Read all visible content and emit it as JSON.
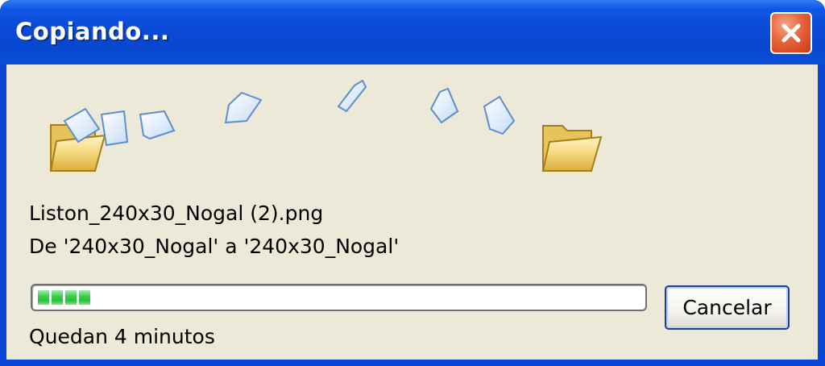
{
  "window": {
    "title": "Copiando...",
    "close_icon": "close-x-icon"
  },
  "animation": {
    "source_icon": "folder-open-icon",
    "destination_icon": "folder-icon",
    "flying_icon": "document-icon"
  },
  "file": {
    "name": "Liston_240x30_Nogal (2).png",
    "from_to": "De '240x30_Nogal' a '240x30_Nogal'"
  },
  "progress": {
    "segments_filled": 4,
    "color": "#2fc340"
  },
  "status": {
    "time_remaining": "Quedan 4 minutos"
  },
  "buttons": {
    "cancel_label": "Cancelar"
  }
}
